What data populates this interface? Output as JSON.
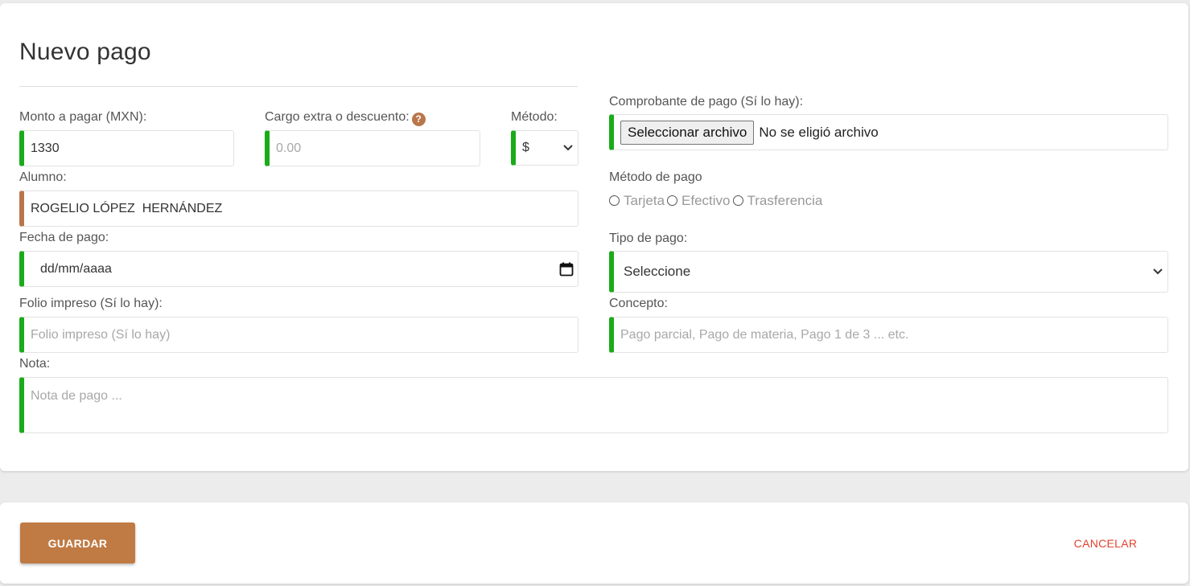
{
  "title": "Nuevo pago",
  "form": {
    "monto": {
      "label": "Monto a pagar (MXN):",
      "value": "1330"
    },
    "cargo": {
      "label": "Cargo extra o descuento:",
      "placeholder": "0.00",
      "help_icon": "question-circle-icon"
    },
    "metodo": {
      "label": "Método:",
      "selected": "$"
    },
    "alumno": {
      "label": "Alumno:",
      "value": "ROGELIO LÓPEZ  HERNÁNDEZ"
    },
    "fecha": {
      "label": "Fecha de pago:",
      "placeholder": "dd/mm/aaaa",
      "icon": "calendar-icon"
    },
    "folio": {
      "label": "Folio impreso (Sí lo hay):",
      "placeholder": "Folio impreso (Sí lo hay)"
    },
    "nota": {
      "label": "Nota:",
      "placeholder": "Nota de pago ..."
    },
    "comprobante": {
      "label": "Comprobante de pago (Sí lo hay):",
      "button": "Seleccionar archivo",
      "status": "No se eligió archivo"
    },
    "metodo_pago": {
      "label": "Método de pago",
      "options": [
        "Tarjeta",
        "Efectivo",
        "Trasferencia"
      ]
    },
    "tipo_pago": {
      "label": "Tipo de pago:",
      "selected": "Seleccione"
    },
    "concepto": {
      "label": "Concepto:",
      "placeholder": "Pago parcial, Pago de materia, Pago 1 de 3 ... etc."
    }
  },
  "footer": {
    "save": "GUARDAR",
    "cancel": "CANCELAR"
  },
  "colors": {
    "accent_green": "#1aab1a",
    "accent_brown": "#b8764a",
    "button": "#c07a43",
    "cancel": "#e2432f"
  }
}
